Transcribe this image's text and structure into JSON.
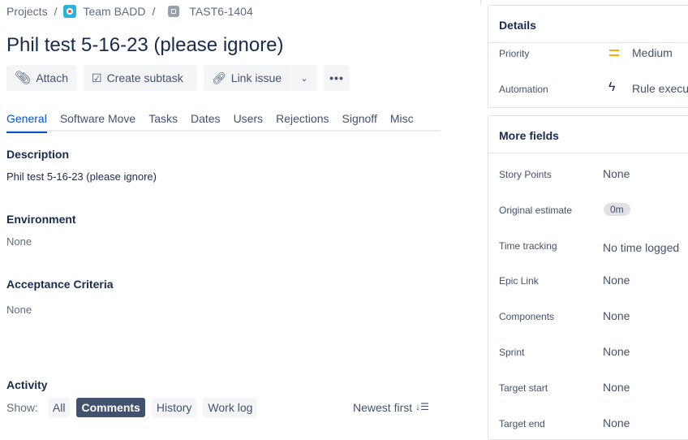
{
  "breadcrumb": {
    "projects": "Projects",
    "project": "Team BADD",
    "issue": "TAST6-1404",
    "sep": "/"
  },
  "title": "Phil test 5-16-23 (please ignore)",
  "toolbar": {
    "attach": "Attach",
    "create_subtask": "Create subtask",
    "link_issue": "Link issue"
  },
  "tabs": [
    "General",
    "Software Move",
    "Tasks",
    "Dates",
    "Users",
    "Rejections",
    "Signoff",
    "Misc"
  ],
  "fields": {
    "description_label": "Description",
    "description": "Phil test 5-16-23 (please ignore)",
    "environment_label": "Environment",
    "environment": "None",
    "acceptance_label": "Acceptance Criteria",
    "acceptance": "None"
  },
  "activity": {
    "label": "Activity",
    "show": "Show:",
    "filters": [
      "All",
      "Comments",
      "History",
      "Work log"
    ],
    "sort": "Newest first"
  },
  "details": {
    "title": "Details",
    "priority_label": "Priority",
    "priority": "Medium",
    "automation_label": "Automation",
    "automation": "Rule execut"
  },
  "more_fields": {
    "title": "More fields",
    "rows": [
      {
        "label": "Story Points",
        "value": "None"
      },
      {
        "label": "Original estimate",
        "value": "0m"
      },
      {
        "label": "Time tracking",
        "value": "No time logged"
      },
      {
        "label": "Epic Link",
        "value": "None"
      },
      {
        "label": "Components",
        "value": "None"
      },
      {
        "label": "Sprint",
        "value": "None"
      },
      {
        "label": "Target start",
        "value": "None"
      },
      {
        "label": "Target end",
        "value": "None"
      }
    ]
  },
  "colors": {
    "accent": "#0052cc",
    "priority_medium": "#ffab00"
  }
}
